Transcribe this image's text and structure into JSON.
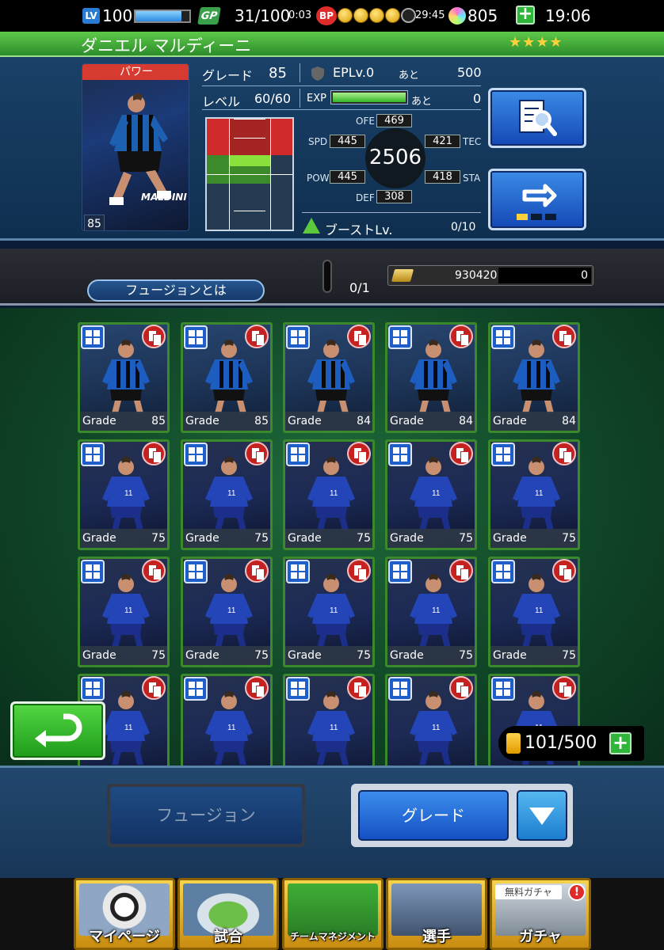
{
  "status": {
    "lv_label": "LV",
    "level": "100",
    "level_progress": 0.85,
    "gp_label": "GP",
    "gp": "31/100",
    "gp_timer": "0:03",
    "bp_label": "BP",
    "bp_coins_filled": 4,
    "bp_coins_total": 5,
    "bp_timer": "29:45",
    "gems": "805",
    "plus": "+",
    "clock": "19:06"
  },
  "player": {
    "name": "ダニエル マルディーニ",
    "stars": "★★★★",
    "position": "パワー",
    "card_name": "MALDINI",
    "card_grade": "85",
    "grade_label": "グレード",
    "grade_value": "85",
    "epl_label": "EPLv.0",
    "epl_remaining_label": "あと",
    "epl_remaining": "500",
    "level_label": "レベル",
    "level_value": "60/60",
    "exp_label": "EXP",
    "exp_remaining_label": "あと",
    "exp_remaining": "0",
    "exp_progress": 1.0,
    "overall": "2506",
    "stats": {
      "ofe_label": "OFE",
      "ofe": "469",
      "spd_label": "SPD",
      "spd": "445",
      "tec_label": "TEC",
      "tec": "421",
      "pow_label": "POW",
      "pow": "445",
      "sta_label": "STA",
      "sta": "418",
      "def_label": "DEF",
      "def": "308"
    },
    "boost_label": "ブーストLv.",
    "boost_value": "0/10"
  },
  "fusion_info": {
    "what_is_fusion": "フュージョンとは",
    "slot_count": "0/1",
    "money": "930420",
    "cost": "0"
  },
  "cards": [
    {
      "grade_label": "Grade",
      "grade": "85",
      "type": "club"
    },
    {
      "grade_label": "Grade",
      "grade": "85",
      "type": "club"
    },
    {
      "grade_label": "Grade",
      "grade": "84",
      "type": "club"
    },
    {
      "grade_label": "Grade",
      "grade": "84",
      "type": "club"
    },
    {
      "grade_label": "Grade",
      "grade": "84",
      "type": "club"
    },
    {
      "grade_label": "Grade",
      "grade": "75",
      "type": "italy"
    },
    {
      "grade_label": "Grade",
      "grade": "75",
      "type": "italy"
    },
    {
      "grade_label": "Grade",
      "grade": "75",
      "type": "italy"
    },
    {
      "grade_label": "Grade",
      "grade": "75",
      "type": "italy"
    },
    {
      "grade_label": "Grade",
      "grade": "75",
      "type": "italy"
    },
    {
      "grade_label": "Grade",
      "grade": "75",
      "type": "italy"
    },
    {
      "grade_label": "Grade",
      "grade": "75",
      "type": "italy"
    },
    {
      "grade_label": "Grade",
      "grade": "75",
      "type": "italy"
    },
    {
      "grade_label": "Grade",
      "grade": "75",
      "type": "italy"
    },
    {
      "grade_label": "Grade",
      "grade": "75",
      "type": "italy"
    },
    {
      "grade_label": "",
      "grade": "",
      "type": "italy"
    },
    {
      "grade_label": "",
      "grade": "",
      "type": "italy"
    },
    {
      "grade_label": "",
      "grade": "",
      "type": "italy"
    },
    {
      "grade_label": "",
      "grade": "",
      "type": "italy"
    },
    {
      "grade_label": "",
      "grade": "",
      "type": "italy"
    }
  ],
  "card_counter": "101/500",
  "actions": {
    "fusion": "フュージョン",
    "sort": "グレード"
  },
  "nav": [
    {
      "label": "マイページ",
      "icon": "efootball-logo-icon"
    },
    {
      "label": "試合",
      "icon": "stadium-icon"
    },
    {
      "label": "チームマネジメント",
      "icon": "formation-board-icon"
    },
    {
      "label": "選手",
      "icon": "players-icon"
    },
    {
      "label": "ガチャ",
      "icon": "gacha-cards-icon",
      "badge": "!",
      "tag": "無料ガチャ"
    }
  ],
  "colors": {
    "name_bar": "#3fae37",
    "accent_blue": "#1f5ec9",
    "card_border": "#3a8a2c",
    "nav_gold": "#f6d34a"
  }
}
